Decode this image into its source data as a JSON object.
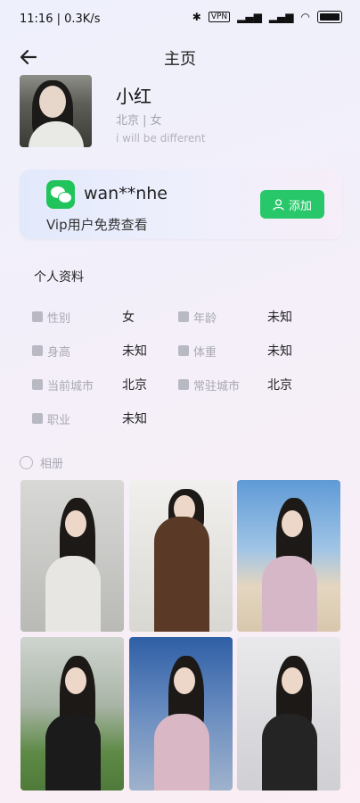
{
  "status": {
    "time_speed": "11:16 | 0.3K/s",
    "icons": [
      "usb-debug-icon",
      "alarm-icon",
      "bluetooth-icon",
      "vpn-icon",
      "signal-icon",
      "signal-icon",
      "wifi-icon",
      "battery-icon"
    ],
    "vpn": "VPN"
  },
  "nav": {
    "title": "主页"
  },
  "profile": {
    "name": "小红",
    "meta": "北京 | 女",
    "bio": "i will be different"
  },
  "wechat": {
    "id": "wan**nhe",
    "subtitle": "Vip用户免费查看",
    "add_label": "添加",
    "brand_color": "#28c76a"
  },
  "info": {
    "title": "个人资料",
    "rows": [
      [
        {
          "label": "性别",
          "value": "女"
        },
        {
          "label": "年龄",
          "value": "未知"
        }
      ],
      [
        {
          "label": "身高",
          "value": "未知"
        },
        {
          "label": "体重",
          "value": "未知"
        }
      ],
      [
        {
          "label": "当前城市",
          "value": "北京"
        },
        {
          "label": "常驻城市",
          "value": "北京"
        }
      ],
      [
        {
          "label": "职业",
          "value": "未知"
        }
      ]
    ]
  },
  "album": {
    "label": "相册"
  }
}
